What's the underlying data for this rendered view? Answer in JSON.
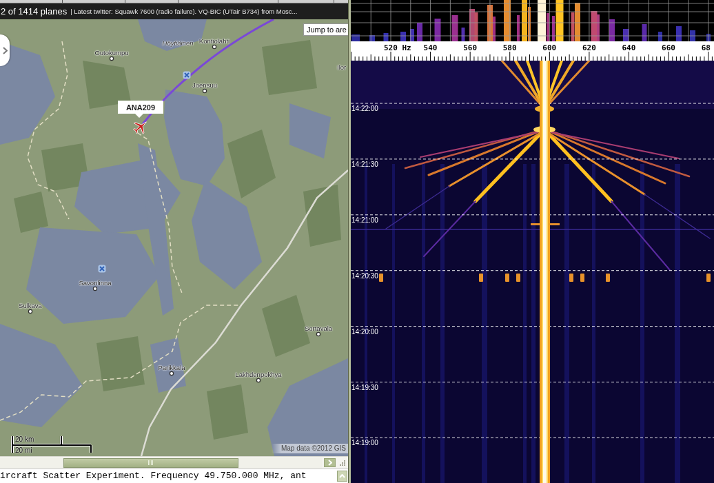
{
  "map_panel": {
    "header": {
      "plane_count": "2 of 1414 planes",
      "news": "| Latest twitter: Squawk 7600 (radio failure). VQ-BIC (UTair B734) from Mosc..."
    },
    "jump_button": "Jump to are",
    "places": [
      {
        "name": "Kontiolahti",
        "kind": "town"
      },
      {
        "name": "Höytiäinen",
        "kind": "water"
      },
      {
        "name": "Outokumpu",
        "kind": "town"
      },
      {
        "name": "Ilor",
        "kind": "label"
      },
      {
        "name": "Joensuu",
        "kind": "town"
      },
      {
        "name": "Savonlinna",
        "kind": "town"
      },
      {
        "name": "Sulkava",
        "kind": "town"
      },
      {
        "name": "Sortavala",
        "kind": "town"
      },
      {
        "name": "Parikkala",
        "kind": "town"
      },
      {
        "name": "Lakhdenpokhya",
        "kind": "town"
      }
    ],
    "flight_label": "ANA209",
    "scale": {
      "metric": "20 km",
      "imperial": "20 mi"
    },
    "attribution": "Map data ©2012 GIS"
  },
  "log": {
    "text": "ircraft Scatter Experiment. Frequency 49.750.000 MHz, ant"
  },
  "spectrogram": {
    "frequency_labels": [
      "520 Hz",
      "540",
      "560",
      "580",
      "600",
      "620",
      "640",
      "660",
      "68"
    ],
    "time_labels": [
      "14:22:00",
      "14:21:30",
      "14:21:00",
      "14:20:30",
      "14:20:00",
      "14:19:30",
      "14:19:00"
    ]
  }
}
